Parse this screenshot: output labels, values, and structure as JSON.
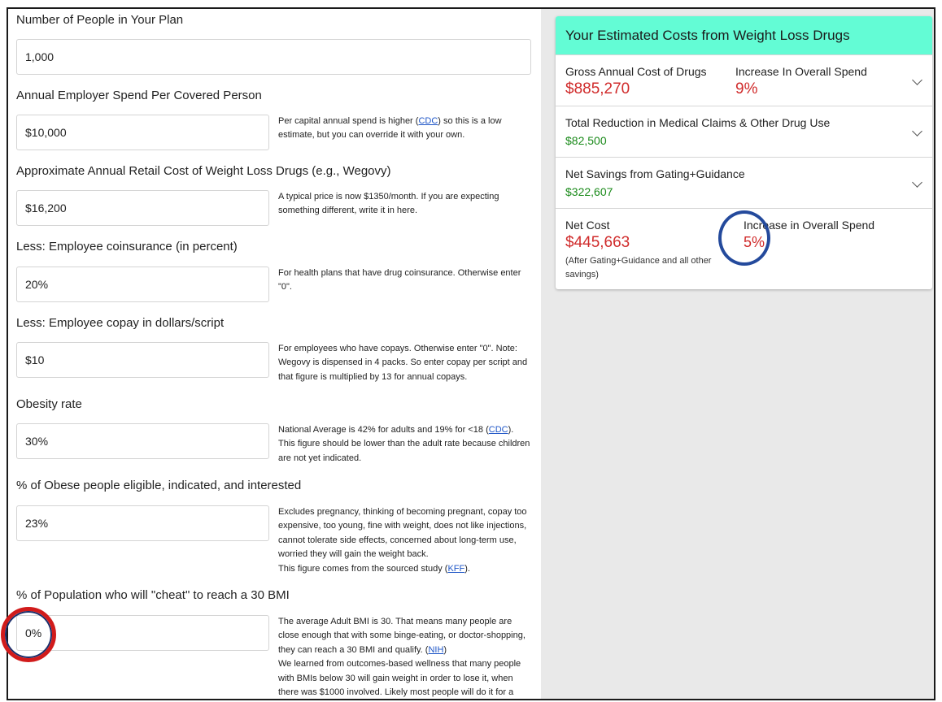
{
  "form": {
    "people": {
      "label": "Number of People in Your Plan",
      "value": "1,000"
    },
    "spend": {
      "label": "Annual Employer Spend Per Covered Person",
      "value": "$10,000",
      "help_a": "Per capital annual spend is higher (",
      "help_link": "CDC",
      "help_b": ") so this is a low estimate, but you can override it with your own."
    },
    "cost": {
      "label": "Approximate Annual Retail Cost of Weight Loss Drugs (e.g., Wegovy)",
      "value": "$16,200",
      "help": "A typical price is now $1350/month. If you are expecting something different, write it in here."
    },
    "coinsurance": {
      "label": "Less: Employee coinsurance (in percent)",
      "value": "20%",
      "help": "For health plans that have drug coinsurance. Otherwise enter \"0\"."
    },
    "copay": {
      "label": "Less: Employee copay in dollars/script",
      "value": "$10",
      "help": "For employees who have copays. Otherwise enter \"0\". Note: Wegovy is dispensed in 4 packs. So enter copay per script and that figure is multiplied by 13 for annual copays."
    },
    "obesity": {
      "label": "Obesity rate",
      "value": "30%",
      "help_a": "National Average is 42% for adults and 19% for <18 (",
      "help_link": "CDC",
      "help_b": "). This figure should be lower than the adult rate because children are not yet indicated."
    },
    "eligible": {
      "label": "% of Obese people eligible, indicated, and interested",
      "value": "23%",
      "help_a": "Excludes pregnancy, thinking of becoming pregnant, copay too expensive, too young, fine with weight, does not like injections, cannot tolerate side effects, concerned about long-term use, worried they will gain the weight back.",
      "help_b": "This figure comes from the sourced study (",
      "help_link": "KFF",
      "help_c": ")."
    },
    "cheat": {
      "label": "% of Population who will \"cheat\" to reach a 30 BMI",
      "value": "0%",
      "help_a": "The average Adult BMI is 30. That means many people are close enough that with some binge-eating, or doctor-shopping, they can reach a 30 BMI and qualify. (",
      "help_link": "NIH",
      "help_b": ")",
      "help_c": "We learned from outcomes-based wellness that many people with BMIs below 30 will gain weight in order to lose it, when there was $1000 involved. Likely most people will do it for a"
    }
  },
  "results": {
    "title": "Your Estimated Costs from Weight Loss Drugs",
    "gross_label": "Gross Annual Cost of Drugs",
    "gross_value": "$885,270",
    "increase_label": "Increase In Overall Spend",
    "increase_value": "9%",
    "reduction_label": "Total Reduction in Medical Claims & Other Drug Use",
    "reduction_value": "$82,500",
    "net_savings_label": "Net Savings from Gating+Guidance",
    "net_savings_value": "$322,607",
    "net_cost_label": "Net Cost",
    "net_cost_value": "$445,663",
    "net_cost_note": "(After Gating+Guidance and all other savings)",
    "net_increase_label": "Increase in Overall Spend",
    "net_increase_value": "5%"
  }
}
